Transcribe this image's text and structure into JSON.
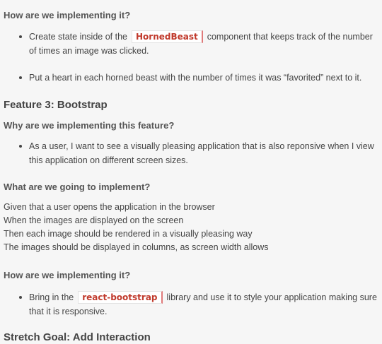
{
  "sections": {
    "how1_heading": "How are we implementing it?",
    "how1_items": [
      {
        "before": "Create state inside of the",
        "code": "HornedBeast",
        "after": "component that keeps track of the number of times an image was clicked."
      },
      {
        "text": "Put a heart in each horned beast with the number of times it was “favorited” next to it."
      }
    ],
    "feature3_title": "Feature 3: Bootstrap",
    "why_heading": "Why are we implementing this feature?",
    "why_items": [
      "As a user, I want to see a visually pleasing application that is also reponsive when I view this application on different screen sizes."
    ],
    "what_heading": "What are we going to implement?",
    "what_lines": [
      "Given that a user opens the application in the browser",
      "When the images are displayed on the screen",
      "Then each image should be rendered in a visually pleasing way",
      "The images should be displayed in columns, as screen width allows"
    ],
    "how2_heading": "How are we implementing it?",
    "how2_items": [
      {
        "before": "Bring in the",
        "code": "react-bootstrap",
        "after": "library and use it to style your application making sure that it is responsive."
      }
    ],
    "stretch_title": "Stretch Goal: Add Interaction"
  }
}
